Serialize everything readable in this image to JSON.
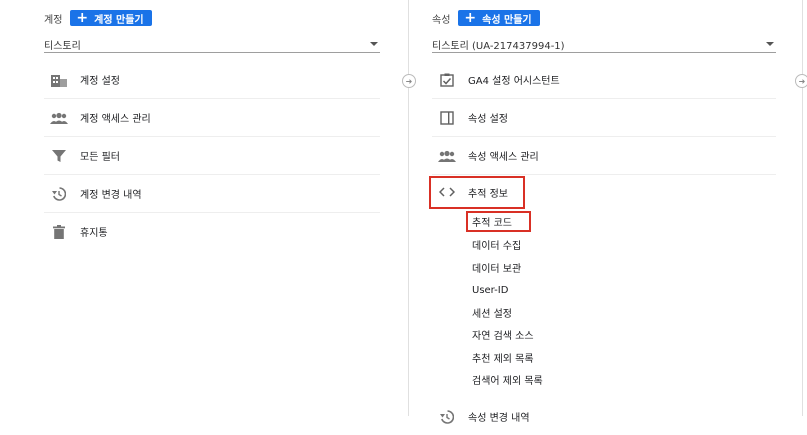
{
  "account": {
    "header_label": "계정",
    "create_button": "계정 만들기",
    "selected": "티스토리",
    "items": [
      {
        "label": "계정 설정",
        "icon": "building-icon"
      },
      {
        "label": "계정 액세스 관리",
        "icon": "people-icon"
      },
      {
        "label": "모든 필터",
        "icon": "filter-icon"
      },
      {
        "label": "계정 변경 내역",
        "icon": "history-icon"
      },
      {
        "label": "휴지통",
        "icon": "trash-icon"
      }
    ]
  },
  "property": {
    "header_label": "속성",
    "create_button": "속성 만들기",
    "selected": "티스토리 (UA-217437994-1)",
    "items": [
      {
        "label": "GA4 설정 어시스턴트",
        "icon": "checkbox-icon"
      },
      {
        "label": "속성 설정",
        "icon": "layout-icon"
      },
      {
        "label": "속성 액세스 관리",
        "icon": "people-icon"
      },
      {
        "label": "추적 정보",
        "icon": "code-icon"
      }
    ],
    "tracking_sub": [
      "추적 코드",
      "데이터 수집",
      "데이터 보관",
      "User-ID",
      "세션 설정",
      "자연 검색 소스",
      "추천 제외 목록",
      "검색어 제외 목록"
    ],
    "bottom_item": {
      "label": "속성 변경 내역",
      "icon": "history-icon"
    }
  },
  "colors": {
    "primary": "#1a73e8",
    "highlight": "#d93025"
  }
}
